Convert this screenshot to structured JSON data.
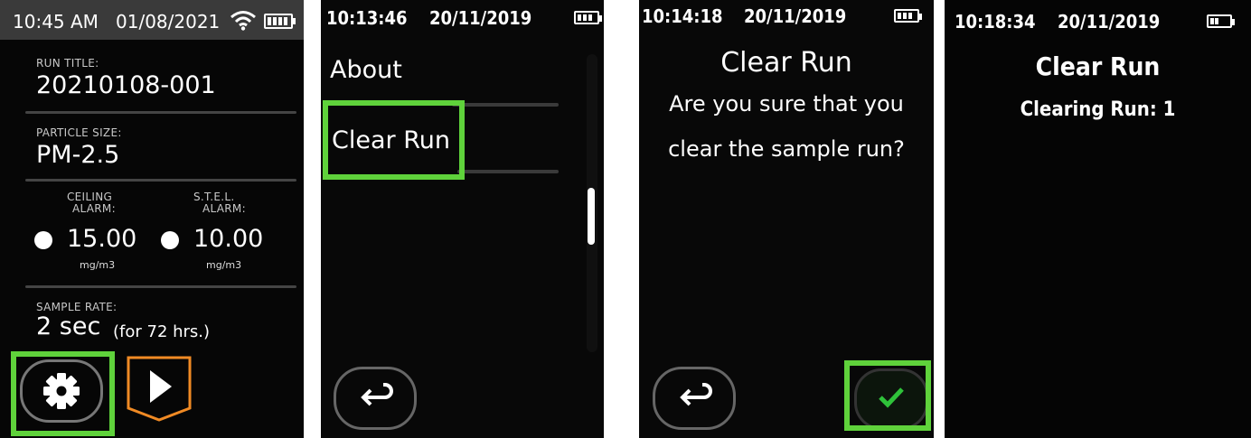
{
  "screens": [
    {
      "status": {
        "time": "10:45 AM",
        "date": "01/08/2021"
      },
      "run_title": {
        "label": "RUN TITLE:",
        "value": "20210108-001"
      },
      "particle_size": {
        "label": "PARTICLE SIZE:",
        "value": "PM-2.5"
      },
      "ceiling_alarm": {
        "label1": "CEILING",
        "label2": "ALARM:",
        "value": "15.00",
        "unit": "mg/m3"
      },
      "stel_alarm": {
        "label1": "S.T.E.L.",
        "label2": "ALARM:",
        "value": "10.00",
        "unit": "mg/m3"
      },
      "sample_rate": {
        "label": "SAMPLE RATE:",
        "value": "2 sec",
        "note": "(for 72 hrs.)"
      }
    },
    {
      "status": {
        "time": "10:13:46",
        "date": "20/11/2019"
      },
      "menu": [
        "About",
        "Clear Run"
      ]
    },
    {
      "status": {
        "time": "10:14:18",
        "date": "20/11/2019"
      },
      "title": "Clear Run",
      "message_line1": "Are you sure that you",
      "message_line2": "clear the sample run?"
    },
    {
      "status": {
        "time": "10:18:34",
        "date": "20/11/2019"
      },
      "title": "Clear Run",
      "message": "Clearing Run: 1"
    }
  ],
  "icons": {
    "settings": "gear-icon",
    "start": "play-icon",
    "back": "back-arrow-icon",
    "confirm": "checkmark-icon",
    "wifi": "wifi-icon",
    "battery": "battery-icon"
  },
  "colors": {
    "highlight": "#5fd23b",
    "play_accent": "#f08a24",
    "confirm_check": "#2fc23a"
  }
}
